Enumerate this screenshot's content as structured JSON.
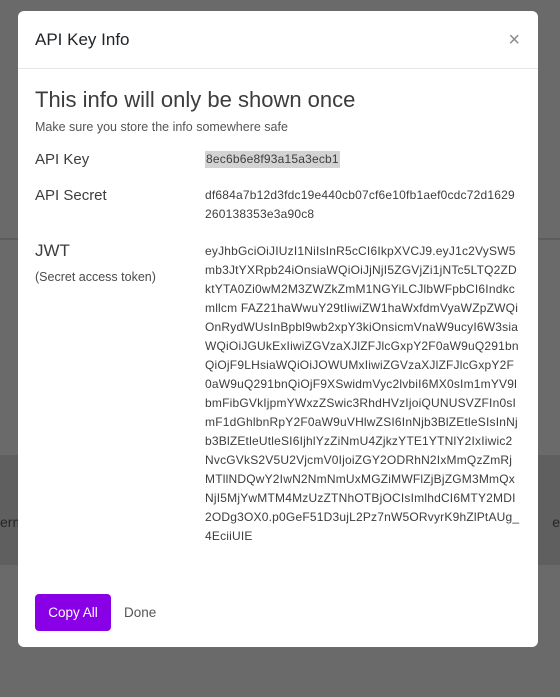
{
  "background": {
    "left_text": "erm",
    "right_text": "e"
  },
  "modal": {
    "title": "API Key Info",
    "close_glyph": "×",
    "headline": "This info will only be shown once",
    "subtext": "Make sure you store the info somewhere safe",
    "api_key": {
      "label": "API Key",
      "value": "8ec6b6e8f93a15a3ecb1"
    },
    "api_secret": {
      "label": "API Secret",
      "value": "df684a7b12d3fdc19e440cb07cf6e10fb1aef0cdc72d1629260138353e3a90c8"
    },
    "jwt": {
      "label": "JWT",
      "sublabel": "(Secret access token)",
      "value": "eyJhbGciOiJIUzI1NiIsInR5cCI6IkpXVCJ9.eyJ1c2VySW5mb3JtYXRpb24iOnsiaWQiOiJjNjI5ZGVjZi1jNTc5LTQ2ZDktYTA0Zi0wM2M3ZWZkZmM1NGYiLCJlbWFpbCI6Indkcmllcm FAZ21haWwuY29tIiwiZW1haWxfdmVyaWZpZWQiOnRydWUsInBpbl9wb2xpY3kiOnsicmVnaW9ucyI6W3siaWQiOiJGUkExIiwiZGVzaXJlZFJlcGxpY2F0aW9uQ291bnQiOjF9LHsiaWQiOiJOWUMxIiwiZGVzaXJlZFJlcGxpY2F0aW9uQ291bnQiOjF9XSwidmVyc2lvbiI6MX0sIm1mYV9lbmFibGVkIjpmYWxzZSwic3RhdHVzIjoiQUNUSVZFIn0sImF1dGhlbnRpY2F0aW9uVHlwZSI6InNjb3BlZEtleSIsInNjb3BlZEtleUtleSI6IjhlYzZiNmU4ZjkzYTE1YTNlY2IxIiwic2NvcGVkS2V5U2VjcmV0IjoiZGY2ODRhN2IxMmQzZmRjMTllNDQwY2IwN2NmNmUxMGZiMWFlZjBjZGM3MmQxNjI5MjYwMTM4MzUzZTNhOTBjOCIsImlhdCI6MTY2MDI2ODg3OX0.p0GeF51D3ujL2Pz7nW5ORvyrK9hZlPtAUg_4EciiUIE"
    },
    "buttons": {
      "copy_all": "Copy All",
      "done": "Done"
    }
  },
  "colors": {
    "accent": "#8a00e6",
    "overlay": "#6a6a6a"
  }
}
